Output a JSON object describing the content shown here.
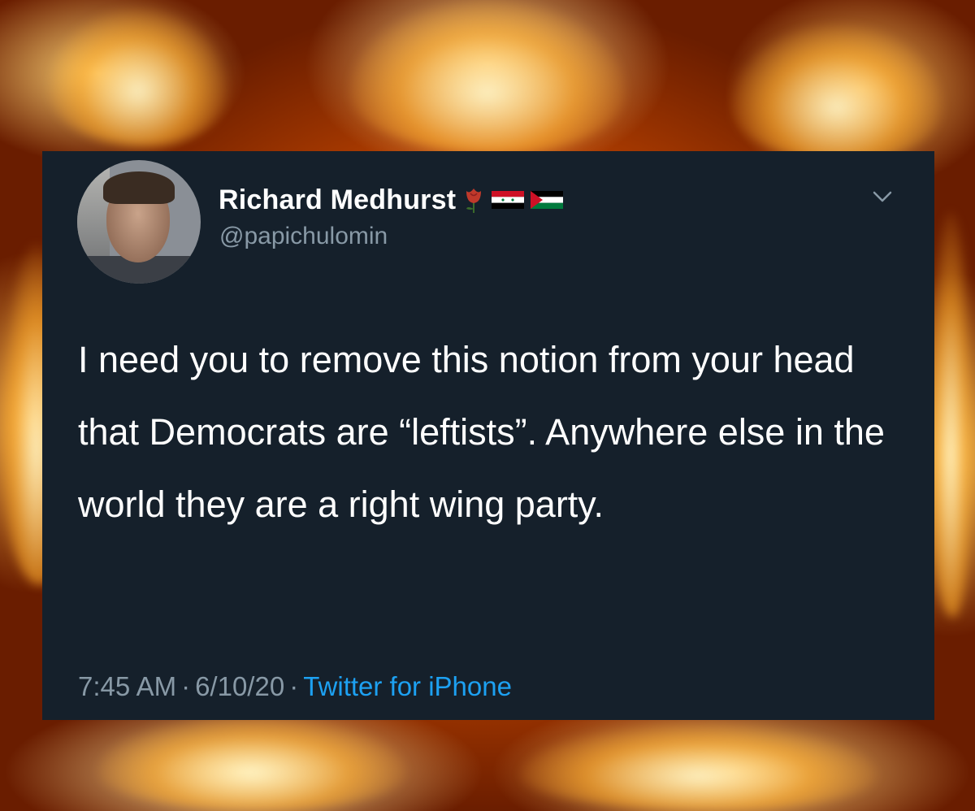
{
  "tweet": {
    "display_name": "Richard Medhurst",
    "handle": "@papichulomin",
    "text": "I need you to remove this notion from your head that Democrats are “leftists”. Anywhere else in the world they are a right wing party.",
    "time": "7:45 AM",
    "date": "6/10/20",
    "separator": "·",
    "source": "Twitter for iPhone",
    "name_icons": [
      "rose-icon",
      "syria-flag-icon",
      "palestine-flag-icon"
    ]
  },
  "colors": {
    "card_background": "#15202b",
    "primary_text": "#ffffff",
    "secondary_text": "#8899a6",
    "link": "#1da1f2"
  }
}
